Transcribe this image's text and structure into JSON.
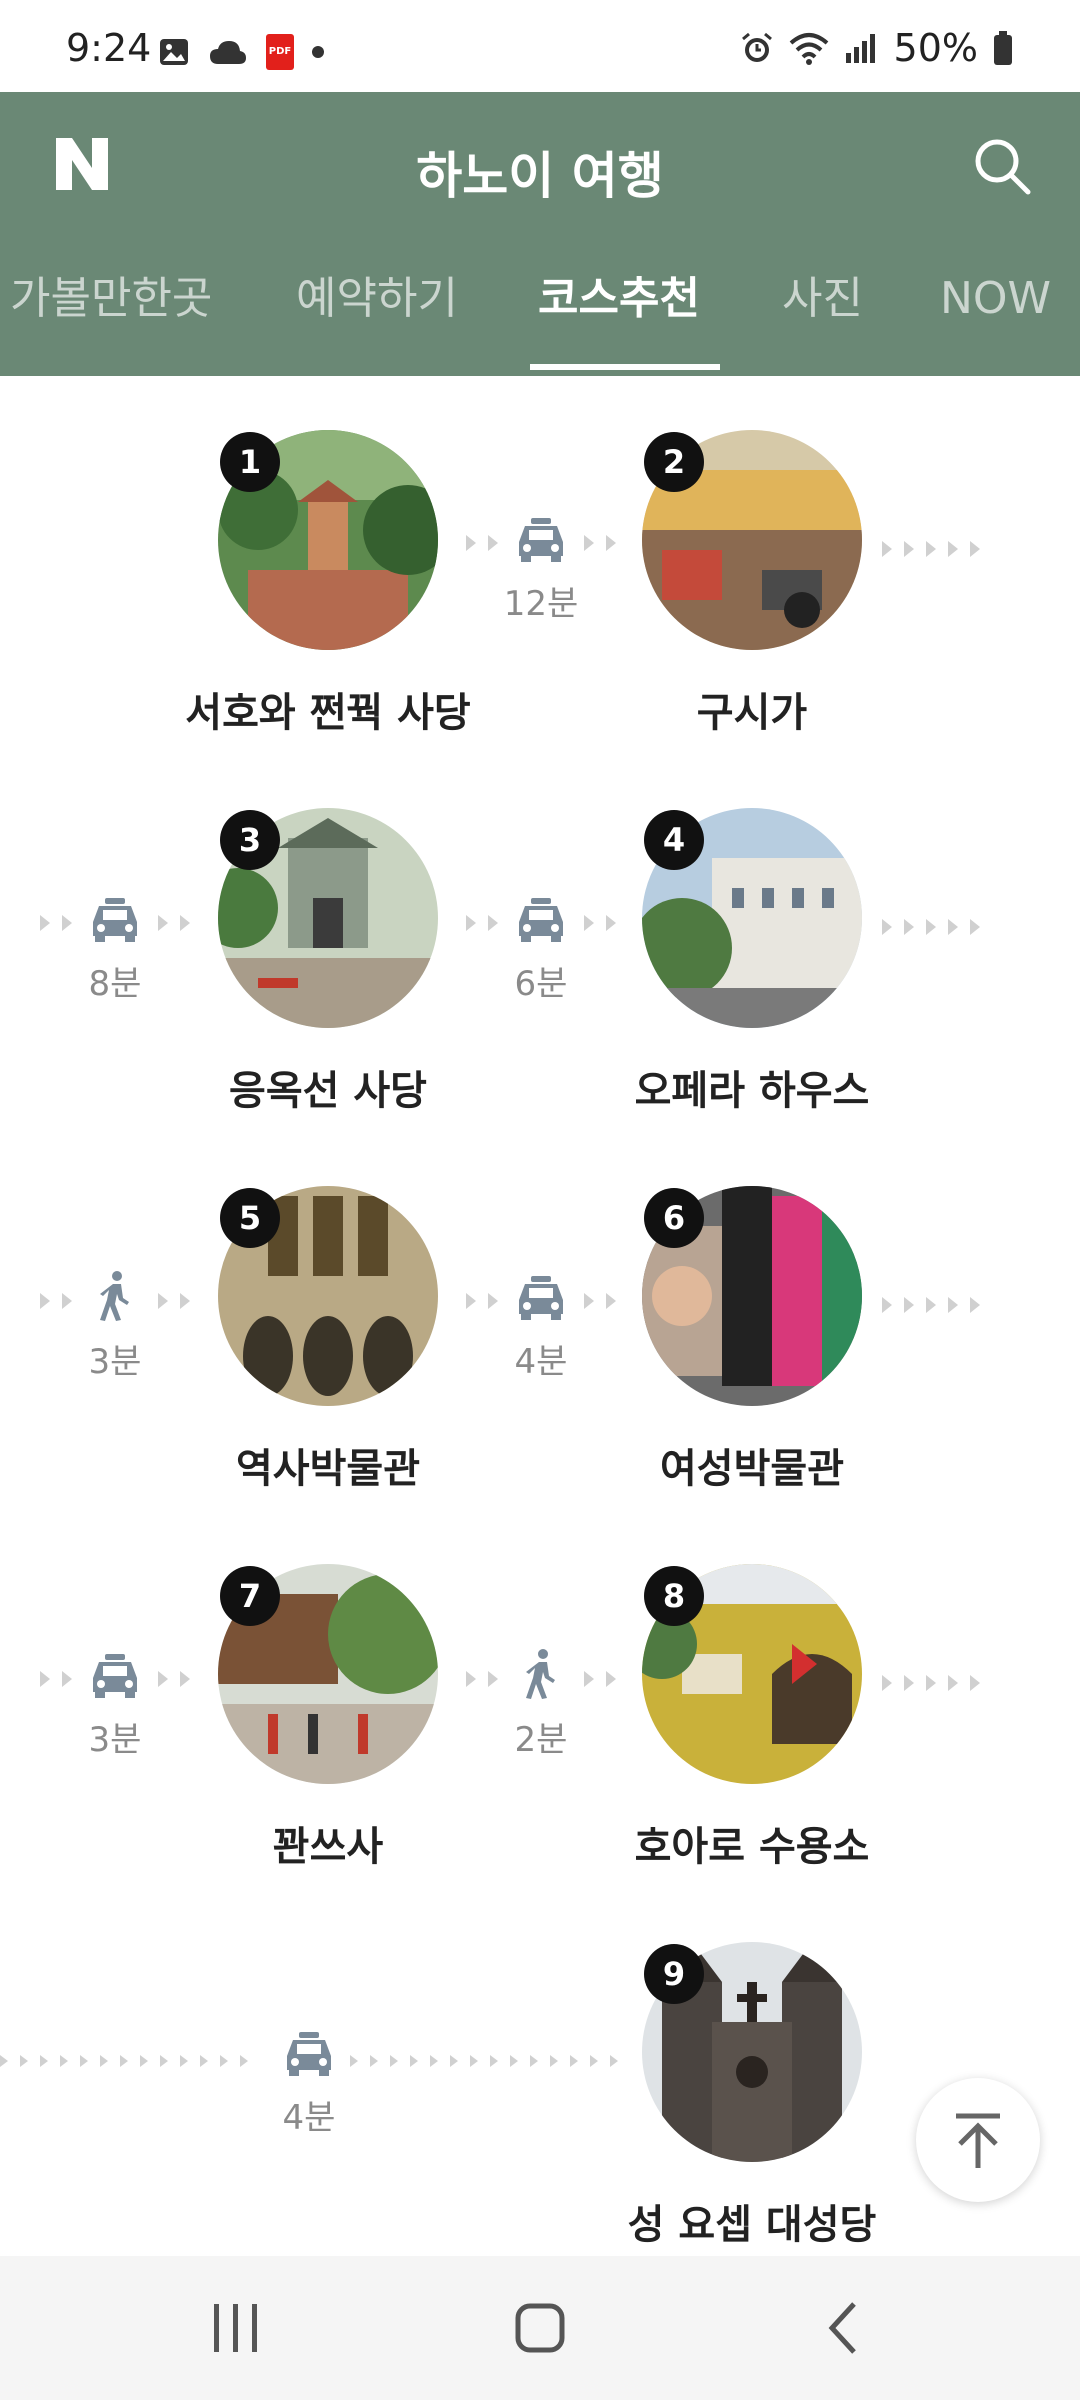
{
  "status": {
    "time": "9:24",
    "battery": "50%"
  },
  "header": {
    "logo": "N",
    "title": "하노이 여행",
    "tabs": [
      "가볼만한곳",
      "예약하기",
      "코스추천",
      "사진",
      "NOW"
    ],
    "active_tab": "코스추천"
  },
  "course": {
    "spots": [
      {
        "num": "1",
        "name": "서호와 쩐꿕 사당"
      },
      {
        "num": "2",
        "name": "구시가"
      },
      {
        "num": "3",
        "name": "응옥선 사당"
      },
      {
        "num": "4",
        "name": "오페라 하우스"
      },
      {
        "num": "5",
        "name": "역사박물관"
      },
      {
        "num": "6",
        "name": "여성박물관"
      },
      {
        "num": "7",
        "name": "꽌쓰사"
      },
      {
        "num": "8",
        "name": "호아로 수용소"
      },
      {
        "num": "9",
        "name": "성 요셉 대성당"
      }
    ],
    "connectors": [
      {
        "mode": "taxi",
        "time": "12분"
      },
      {
        "mode": "taxi",
        "time": "8분"
      },
      {
        "mode": "taxi",
        "time": "6분"
      },
      {
        "mode": "walk",
        "time": "3분"
      },
      {
        "mode": "taxi",
        "time": "4분"
      },
      {
        "mode": "taxi",
        "time": "3분"
      },
      {
        "mode": "walk",
        "time": "2분"
      },
      {
        "mode": "taxi",
        "time": "4분"
      }
    ]
  },
  "colors": {
    "header_bg": "#6a8875",
    "arrow": "#d0d0d0",
    "mode_icon": "#7a8a99"
  }
}
